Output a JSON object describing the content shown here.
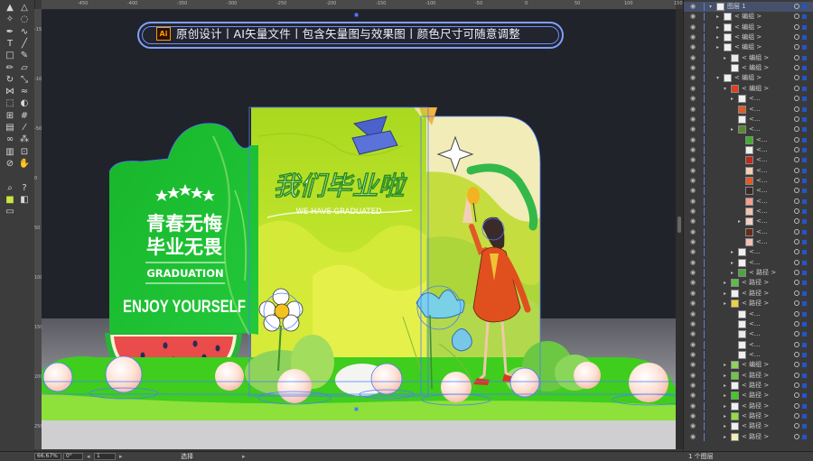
{
  "banner": {
    "logo": "Ai",
    "text": "原创设计丨AI矢量文件丨包含矢量图与效果图丨颜色尺寸可随意调整"
  },
  "design": {
    "title": "我们毕业啦",
    "subtitle": "WE HAVE GRADUATED",
    "slogan_line1": "青春无悔",
    "slogan_line2": "毕业无畏",
    "graduation": "GRADUATION",
    "enjoy": "ENJOY YOURSELF"
  },
  "rulers": {
    "top": [
      "-450",
      "-400",
      "-350",
      "-300",
      "-250",
      "-200",
      "-150",
      "-100",
      "-50",
      "0",
      "50",
      "100",
      "150"
    ],
    "left": [
      "-150",
      "-100",
      "-50",
      "0",
      "50",
      "100",
      "150",
      "200",
      "250"
    ]
  },
  "toolbar": {
    "icons": [
      "selection-icon",
      "direct-selection-icon",
      "magic-wand-icon",
      "lasso-icon",
      "pen-icon",
      "curvature-icon",
      "type-icon",
      "line-icon",
      "rectangle-icon",
      "paintbrush-icon",
      "pencil-icon",
      "eraser-icon",
      "rotate-icon",
      "scale-icon",
      "width-icon",
      "warp-icon",
      "free-transform-icon",
      "shape-builder-icon",
      "perspective-icon",
      "mesh-icon",
      "gradient-icon",
      "eyedropper-icon",
      "blend-icon",
      "symbol-sprayer-icon",
      "graph-icon",
      "artboard-icon",
      "slice-icon",
      "hand-icon",
      "zoom-icon",
      "help-icon",
      "fill-stroke-icon",
      "draw-mode-icon",
      "screen-mode-icon"
    ]
  },
  "layers": {
    "top_layer": "图层 1",
    "group_label": "< 编组 >",
    "path_label": "< 路径 >",
    "ellipsis": "<...",
    "footer": "1 个图层"
  },
  "status": {
    "zoom": "66.67%",
    "rotation": "0°",
    "artboard": "1",
    "tool": "选择"
  },
  "colors": {
    "app_bg": "#3a3a3a",
    "canvas_bg": "#21232b",
    "selection_blue": "#4a7cff",
    "green_dark": "#1fbf2a",
    "lime": "#b8e02a",
    "cream": "#f2ecb8",
    "gown_orange": "#e0501f"
  }
}
